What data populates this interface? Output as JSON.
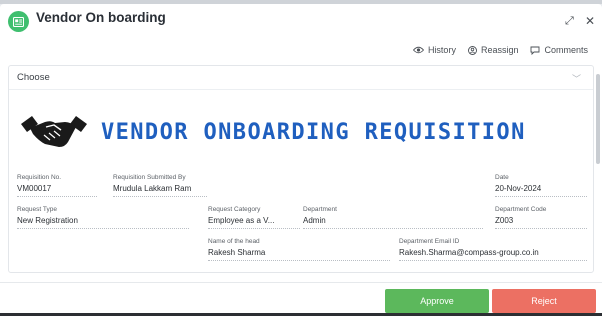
{
  "window": {
    "title": "Vendor On boarding",
    "expand_icon": "expand-icon",
    "close_icon": "close-icon"
  },
  "actions": {
    "history": "History",
    "reassign": "Reassign",
    "comments": "Comments"
  },
  "section": {
    "choose_label": "Choose"
  },
  "banner": {
    "title": "VENDOR ONBOARDING REQUISITION",
    "icon": "handshake-icon"
  },
  "fields": {
    "requisition_no": {
      "label": "Requisition No.",
      "value": "VM00017"
    },
    "submitted_by": {
      "label": "Requisition Submitted By",
      "value": "Mrudula Lakkam Ram"
    },
    "date": {
      "label": "Date",
      "value": "20-Nov-2024"
    },
    "request_type": {
      "label": "Request Type",
      "value": "New Registration"
    },
    "request_category": {
      "label": "Request Category",
      "value": "Employee as a V..."
    },
    "department": {
      "label": "Department",
      "value": "Admin"
    },
    "department_code": {
      "label": "Department Code",
      "value": "Z003"
    },
    "head_name": {
      "label": "Name of the head",
      "value": "Rakesh Sharma"
    },
    "department_email": {
      "label": "Department Email ID",
      "value": "Rakesh.Sharma@compass-group.co.in"
    }
  },
  "buttons": {
    "approve": "Approve",
    "reject": "Reject"
  },
  "colors": {
    "brand_green": "#3fbf6f",
    "title_blue": "#1f5fbf",
    "approve": "#5cb85c",
    "reject": "#ec7063"
  }
}
